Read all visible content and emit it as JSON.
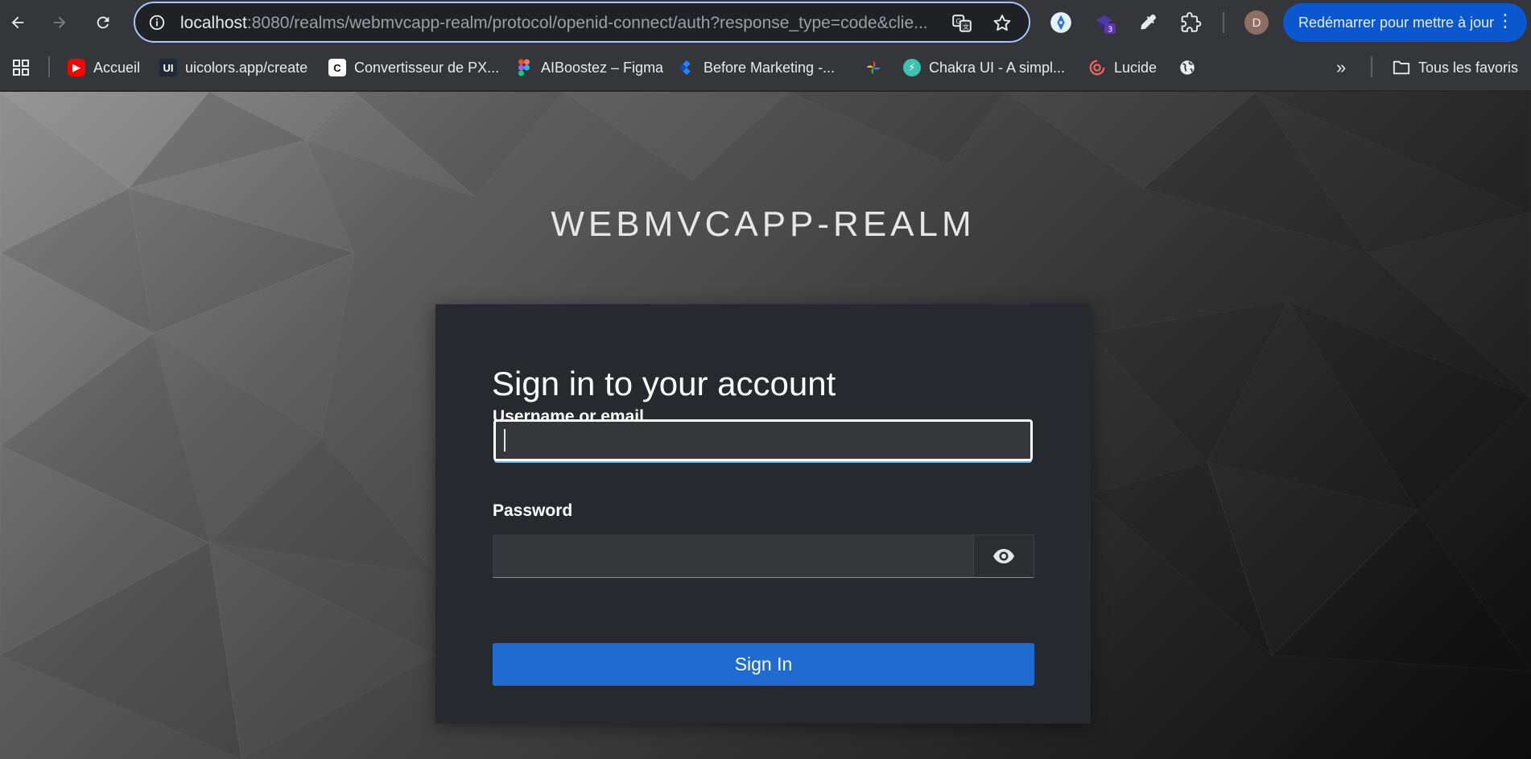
{
  "browser": {
    "url_host": "localhost",
    "url_rest": ":8080/realms/webmvcapp-realm/protocol/openid-connect/auth?response_type=code&clie...",
    "extension_badge": "3",
    "avatar_letter": "D",
    "update_button": "Redémarrer pour mettre à jour",
    "accent_color": "#0b57d0"
  },
  "bookmarks": {
    "items": [
      {
        "label": "Accueil",
        "icon": "youtube-icon"
      },
      {
        "label": "uicolors.app/create",
        "icon": "uicolors-icon"
      },
      {
        "label": "Convertisseur de PX...",
        "icon": "c-icon"
      },
      {
        "label": "AIBoostez – Figma",
        "icon": "figma-icon"
      },
      {
        "label": "Before Marketing -...",
        "icon": "jira-icon"
      },
      {
        "label": "",
        "icon": "pinwheel-icon"
      },
      {
        "label": "Chakra UI - A simpl...",
        "icon": "chakra-icon"
      },
      {
        "label": "Lucide",
        "icon": "lucide-icon"
      },
      {
        "label": "",
        "icon": "globe-icon"
      }
    ],
    "all_bookmarks": "Tous les favoris"
  },
  "page": {
    "realm_title": "WEBMVCAPP-REALM",
    "card_title": "Sign in to your account",
    "username_label": "Username or email",
    "username_value": "",
    "password_label": "Password",
    "password_value": "",
    "signin_button": "Sign In",
    "button_color": "#1f6bd1"
  }
}
